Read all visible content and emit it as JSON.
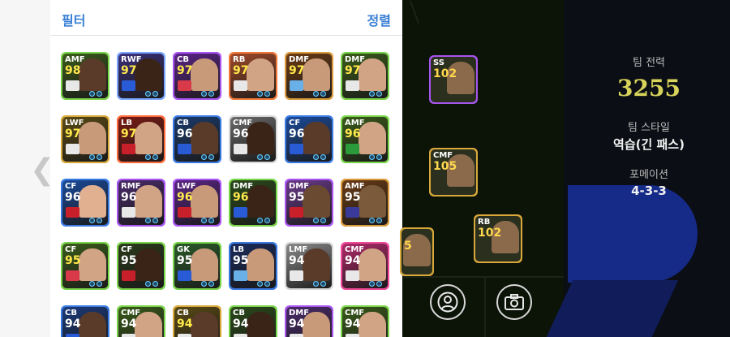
{
  "panel": {
    "filter_label": "필터",
    "sort_label": "정렬"
  },
  "players": [
    {
      "pos": "AMF",
      "ovr": "98",
      "border": "#7ad44a",
      "bg": "#3a5b1a",
      "num": "#ffe94b",
      "flag": "#e8e8e8",
      "face": "#5a3b2a"
    },
    {
      "pos": "RWF",
      "ovr": "97",
      "border": "#7aa6ff",
      "bg": "#3a2f7a",
      "num": "#ffe94b",
      "flag": "#2a5bd6",
      "face": "#3a2418"
    },
    {
      "pos": "CB",
      "ovr": "97",
      "border": "#a855f0",
      "bg": "#5a2486",
      "num": "#ffe94b",
      "flag": "#d83a4a",
      "face": "#c89a7a"
    },
    {
      "pos": "RB",
      "ovr": "97",
      "border": "#f07a3a",
      "bg": "#a04a2a",
      "num": "#ffe94b",
      "flag": "#e8e8e8",
      "face": "#d2a486"
    },
    {
      "pos": "DMF",
      "ovr": "97",
      "border": "#d89a3a",
      "bg": "#6a3a14",
      "num": "#ffe94b",
      "flag": "#6ab0e8",
      "face": "#c89a7a"
    },
    {
      "pos": "DMF",
      "ovr": "97",
      "border": "#7ad44a",
      "bg": "#3a5b1a",
      "num": "#ffe94b",
      "flag": "#e8e8e8",
      "face": "#d2a486"
    },
    {
      "pos": "LWF",
      "ovr": "97",
      "border": "#d8a83a",
      "bg": "#5a4a14",
      "num": "#ffe94b",
      "flag": "#e8e8e8",
      "face": "#c89a7a"
    },
    {
      "pos": "LB",
      "ovr": "97",
      "border": "#ff6a3a",
      "bg": "#7a1a14",
      "num": "#ffe94b",
      "flag": "#c8202a",
      "face": "#d2a486"
    },
    {
      "pos": "CB",
      "ovr": "96",
      "border": "#3a7ae0",
      "bg": "#1a3a6a",
      "num": "#ffffff",
      "flag": "#2a5bd6",
      "face": "#5a3b2a"
    },
    {
      "pos": "CMF",
      "ovr": "96",
      "border": "#d8d8d8",
      "bg": "#6a6a6a",
      "num": "#ffffff",
      "flag": "#e8e8e8",
      "face": "#3a2418"
    },
    {
      "pos": "CF",
      "ovr": "96",
      "border": "#3a7ae0",
      "bg": "#1a4a9a",
      "num": "#ffffff",
      "flag": "#2a5bd6",
      "face": "#5a3b2a"
    },
    {
      "pos": "AMF",
      "ovr": "96",
      "border": "#7ad44a",
      "bg": "#3a5b1a",
      "num": "#ffe94b",
      "flag": "#2a9a3a",
      "face": "#d2a486"
    },
    {
      "pos": "CF",
      "ovr": "96",
      "border": "#3a7ae0",
      "bg": "#1a4a9a",
      "num": "#ffffff",
      "flag": "#c8202a",
      "face": "#e0b090"
    },
    {
      "pos": "RMF",
      "ovr": "96",
      "border": "#a855f0",
      "bg": "#4a2a6a",
      "num": "#ffffff",
      "flag": "#e8e8e8",
      "face": "#d2a486"
    },
    {
      "pos": "LWF",
      "ovr": "96",
      "border": "#a855f0",
      "bg": "#5a2486",
      "num": "#ffe94b",
      "flag": "#c8202a",
      "face": "#c89a7a"
    },
    {
      "pos": "DMF",
      "ovr": "96",
      "border": "#7ad44a",
      "bg": "#2a4a1a",
      "num": "#ffe94b",
      "flag": "#2a5bd6",
      "face": "#3a2418"
    },
    {
      "pos": "DMF",
      "ovr": "95",
      "border": "#a855f0",
      "bg": "#6a3a8a",
      "num": "#ffffff",
      "flag": "#c8202a",
      "face": "#6a4a30"
    },
    {
      "pos": "AMF",
      "ovr": "95",
      "border": "#d89a3a",
      "bg": "#6a3a14",
      "num": "#ffffff",
      "flag": "#3a3a9a",
      "face": "#7a5a3a"
    },
    {
      "pos": "CF",
      "ovr": "95",
      "border": "#7ad44a",
      "bg": "#3a5b1a",
      "num": "#ffe94b",
      "flag": "#d83a4a",
      "face": "#d2a486"
    },
    {
      "pos": "CF",
      "ovr": "95",
      "border": "#7ad44a",
      "bg": "#2a3a1a",
      "num": "#ffffff",
      "flag": "#c8202a",
      "face": "#3a2418"
    },
    {
      "pos": "GK",
      "ovr": "95",
      "border": "#7ad44a",
      "bg": "#2a5a2a",
      "num": "#ffffff",
      "flag": "#2a5bd6",
      "face": "#c89a7a"
    },
    {
      "pos": "LB",
      "ovr": "95",
      "border": "#3a7ae0",
      "bg": "#1a2a5a",
      "num": "#ffffff",
      "flag": "#6ab0e8",
      "face": "#c89a7a"
    },
    {
      "pos": "LMF",
      "ovr": "94",
      "border": "#d8d8d8",
      "bg": "#8a8a8a",
      "num": "#ffffff",
      "flag": "#e8e8e8",
      "face": "#5a3b2a"
    },
    {
      "pos": "CMF",
      "ovr": "94",
      "border": "#f04a9a",
      "bg": "#b02a6a",
      "num": "#ffffff",
      "flag": "#e8e8e8",
      "face": "#d2a486"
    },
    {
      "pos": "CB",
      "ovr": "94",
      "border": "#3a7ae0",
      "bg": "#1a3a7a",
      "num": "#ffffff",
      "flag": "#2a5bd6",
      "face": "#5a3b2a"
    },
    {
      "pos": "CMF",
      "ovr": "94",
      "border": "#7ad44a",
      "bg": "#3a5b1a",
      "num": "#ffffff",
      "flag": "#e8e8e8",
      "face": "#d2a486"
    },
    {
      "pos": "CB",
      "ovr": "94",
      "border": "#d8a83a",
      "bg": "#5a4a14",
      "num": "#ffe94b",
      "flag": "#e8e8e8",
      "face": "#5a3b2a"
    },
    {
      "pos": "CB",
      "ovr": "94",
      "border": "#7ad44a",
      "bg": "#2a4a1a",
      "num": "#ffffff",
      "flag": "#e8e8e8",
      "face": "#3a2418"
    },
    {
      "pos": "DMF",
      "ovr": "94",
      "border": "#a855f0",
      "bg": "#4a2a6a",
      "num": "#ffffff",
      "flag": "#e8e8e8",
      "face": "#c89a7a"
    },
    {
      "pos": "CMF",
      "ovr": "94",
      "border": "#7ad44a",
      "bg": "#3a5b1a",
      "num": "#ffffff",
      "flag": "#e8e8e8",
      "face": "#d2a486"
    }
  ],
  "lineup": [
    {
      "pos": "SS",
      "ovr": "102",
      "border": "#a855f0"
    },
    {
      "pos": "CMF",
      "ovr": "105",
      "border": "#d8a83a"
    },
    {
      "pos": "RB",
      "ovr": "102",
      "border": "#d8a83a"
    },
    {
      "pos": "",
      "ovr": "5",
      "border": "#d8a83a"
    }
  ],
  "info": {
    "power_label": "팀 전력",
    "power_value": "3255",
    "style_label": "팀 스타일",
    "style_value": "역습(긴 패스)",
    "formation_label": "포메이션",
    "formation_value": "4-3-3"
  }
}
